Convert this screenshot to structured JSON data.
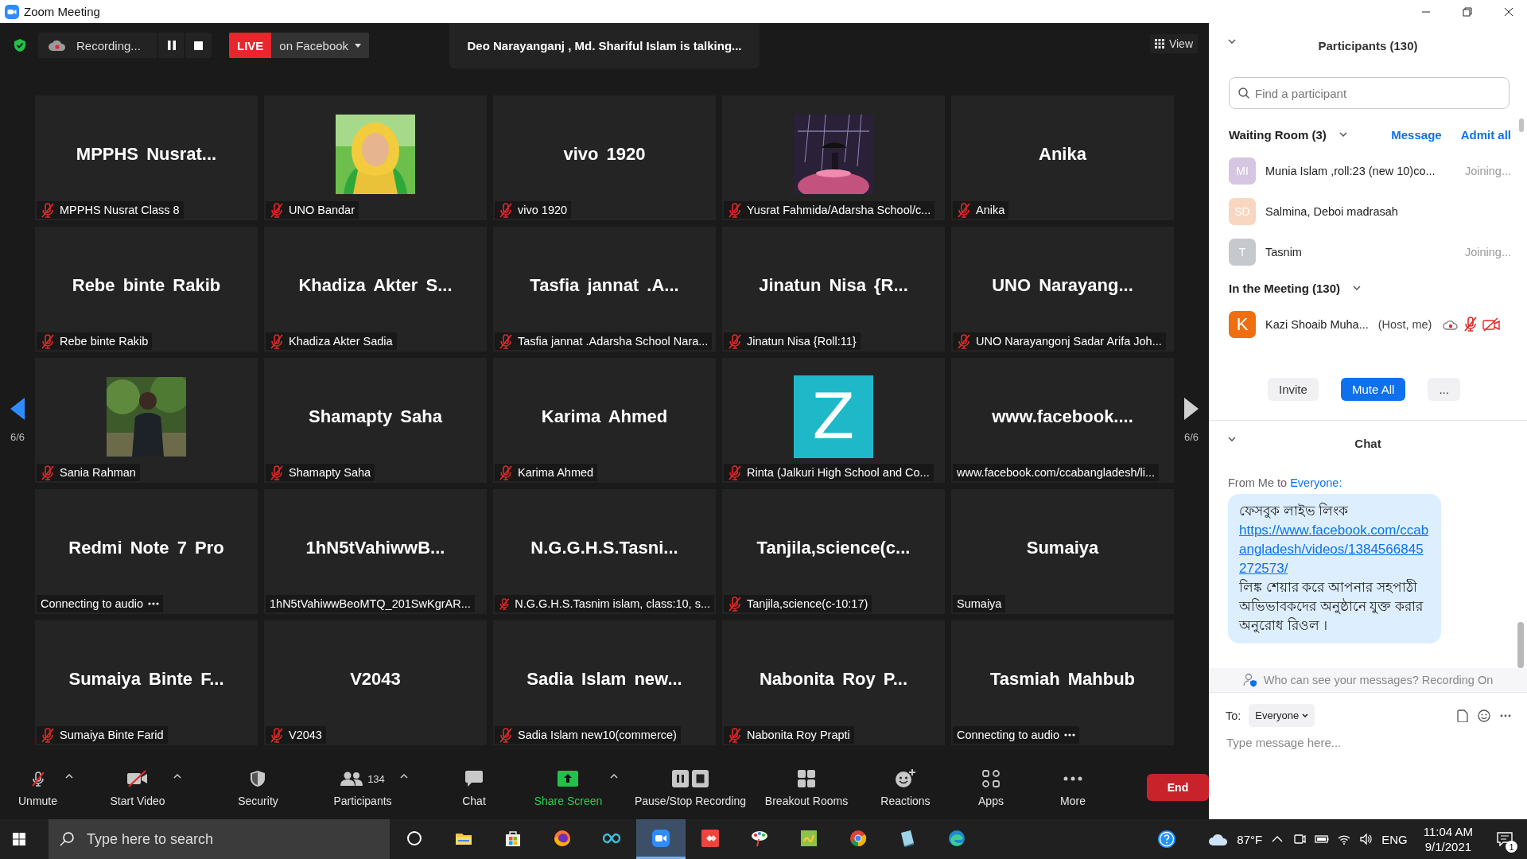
{
  "window": {
    "title": "Zoom Meeting"
  },
  "top_bar": {
    "recording": "Recording...",
    "live_badge": "LIVE",
    "live_target": "on Facebook",
    "talking": "Deo Narayanganj , Md. Shariful Islam is talking...",
    "view": "View"
  },
  "gallery": {
    "page_left": "6/6",
    "page_right": "6/6",
    "tiles": [
      {
        "kind": "name",
        "title": "MPPHS Nusrat...",
        "name": "MPPHS Nusrat Class 8",
        "muted": true,
        "connecting": false
      },
      {
        "kind": "picture",
        "name": "UNO Bandar",
        "muted": true,
        "connecting": false
      },
      {
        "kind": "name",
        "title": "vivo 1920",
        "name": "vivo 1920",
        "muted": true,
        "connecting": false
      },
      {
        "kind": "picture",
        "name": "Yusrat Fahmida/Adarsha School/c...",
        "muted": true,
        "connecting": false
      },
      {
        "kind": "name",
        "title": "Anika",
        "name": "Anika",
        "muted": true,
        "connecting": false
      },
      {
        "kind": "name",
        "title": "Rebe binte Rakib",
        "name": "Rebe binte Rakib",
        "muted": true,
        "connecting": false
      },
      {
        "kind": "name",
        "title": "Khadiza Akter S...",
        "name": "Khadiza Akter Sadia",
        "muted": true,
        "connecting": false
      },
      {
        "kind": "name",
        "title": "Tasfia jannat .A...",
        "name": "Tasfia jannat .Adarsha School Nara...",
        "muted": true,
        "connecting": false
      },
      {
        "kind": "name",
        "title": "Jinatun Nisa {R...",
        "name": "Jinatun Nisa {Roll:11}",
        "muted": true,
        "connecting": false
      },
      {
        "kind": "name",
        "title": "UNO Narayang...",
        "name": "UNO Narayangonj Sadar Arifa Joh...",
        "muted": true,
        "connecting": false
      },
      {
        "kind": "picture",
        "name": "Sania Rahman",
        "muted": true,
        "connecting": false
      },
      {
        "kind": "name",
        "title": "Shamapty Saha",
        "name": "Shamapty Saha",
        "muted": true,
        "connecting": false
      },
      {
        "kind": "name",
        "title": "Karima Ahmed",
        "name": "Karima Ahmed",
        "muted": true,
        "connecting": false
      },
      {
        "kind": "letter",
        "letter": "Z",
        "name": "Rinta (Jalkuri High  School  and Co...",
        "muted": true,
        "connecting": false
      },
      {
        "kind": "name",
        "title": "www.facebook....",
        "name": "www.facebook.com/ccabangladesh/li...",
        "muted": false,
        "connecting": false
      },
      {
        "kind": "name",
        "title": "Redmi Note 7 Pro",
        "name": "Connecting to audio",
        "muted": false,
        "connecting": true
      },
      {
        "kind": "name",
        "title": "1hN5tVahiwwB...",
        "name": "1hN5tVahiwwBeoMTQ_201SwKgrAR...",
        "muted": false,
        "connecting": false
      },
      {
        "kind": "name",
        "title": "N.G.G.H.S.Tasni...",
        "name": "N.G.G.H.S.Tasnim islam, class:10, s...",
        "muted": true,
        "connecting": false
      },
      {
        "kind": "name",
        "title": "Tanjila,science(c...",
        "name": "Tanjila,science(c-10:17)",
        "muted": true,
        "connecting": false
      },
      {
        "kind": "name",
        "title": "Sumaiya",
        "name": "Sumaiya",
        "muted": false,
        "connecting": false
      },
      {
        "kind": "name",
        "title": "Sumaiya Binte F...",
        "name": "Sumaiya Binte Farid",
        "muted": true,
        "connecting": false
      },
      {
        "kind": "name",
        "title": "V2043",
        "name": "V2043",
        "muted": true,
        "connecting": false
      },
      {
        "kind": "name",
        "title": "Sadia Islam new...",
        "name": "Sadia Islam new10(commerce)",
        "muted": true,
        "connecting": false
      },
      {
        "kind": "name",
        "title": "Nabonita Roy P...",
        "name": "Nabonita Roy Prapti",
        "muted": true,
        "connecting": false
      },
      {
        "kind": "name",
        "title": "Tasmiah Mahbub",
        "name": "Connecting to audio",
        "muted": false,
        "connecting": true
      }
    ]
  },
  "toolbar": {
    "items": [
      {
        "kind": "mic",
        "label": "Unmute",
        "off": true,
        "menu": true
      },
      {
        "kind": "video",
        "label": "Start Video",
        "off": true,
        "menu": true
      },
      {
        "kind": "security",
        "label": "Security",
        "menu": false
      },
      {
        "kind": "participants",
        "label": "Participants",
        "count": "134",
        "menu": true
      },
      {
        "kind": "chat",
        "label": "Chat",
        "menu": false
      },
      {
        "kind": "share",
        "label": "Share Screen",
        "menu": true
      },
      {
        "kind": "recording",
        "label": "Pause/Stop Recording",
        "menu": false
      },
      {
        "kind": "breakout",
        "label": "Breakout Rooms",
        "menu": false
      },
      {
        "kind": "reactions",
        "label": "Reactions",
        "menu": false
      },
      {
        "kind": "apps",
        "label": "Apps",
        "menu": false
      },
      {
        "kind": "more",
        "label": "More",
        "menu": false
      }
    ],
    "end": "End"
  },
  "participants": {
    "title": "Participants (130)",
    "search": {
      "placeholder": "Find a participant"
    },
    "waiting_room": {
      "title": "Waiting Room (3)",
      "expanded": true,
      "message": "Message",
      "admit_all": "Admit all",
      "items": [
        {
          "initials": "MI",
          "color": "#d6c6e1",
          "name": "Munia Islam ,roll:23 (new 10)co...",
          "status": "Joining..."
        },
        {
          "initials": "SD",
          "color": "#f9d6bf",
          "name": "Salmina, Deboi madrasah"
        },
        {
          "initials": "T",
          "color": "#c5c8cc",
          "name": "Tasnim",
          "status": "Joining..."
        }
      ]
    },
    "in_meeting": {
      "title": "In the Meeting (130)",
      "expanded": true,
      "items": [
        {
          "initials": "K",
          "color": "#ee6e10",
          "name": "Kazi Shoaib Muha...",
          "role": "(Host, me)",
          "recording": true,
          "muted": true,
          "video_off": true
        }
      ]
    },
    "buttons": {
      "invite": "Invite",
      "mute_all": "Mute All",
      "more": "..."
    }
  },
  "chat": {
    "title": "Chat",
    "from": "From Me to",
    "to": "Everyone:",
    "message": {
      "heading": "ফেসবুক লাইভ লিংক",
      "link": "https://www.facebook.com/ccabangladesh/videos/1384566845272573/",
      "body": "লিঙ্ক শেয়ার করে আপনার সহপাঠী অভিভাবকদের অনুষ্ঠানে যুক্ত করার অনুরোধ রিওল ।"
    },
    "notice": "Who can see your messages? Recording On",
    "to_label": "To:",
    "recipient": "Everyone",
    "input": {
      "placeholder": "Type message here..."
    }
  },
  "taskbar": {
    "search": {
      "placeholder": "Type here to search"
    },
    "apps": [
      {
        "kind": "cortana",
        "active": false
      },
      {
        "kind": "explorer",
        "active": false
      },
      {
        "kind": "store",
        "active": false
      },
      {
        "kind": "firefox",
        "active": false
      },
      {
        "kind": "infinity",
        "active": false
      },
      {
        "kind": "zoom",
        "active": true
      },
      {
        "kind": "anydesk",
        "active": false
      },
      {
        "kind": "paint",
        "active": false
      },
      {
        "kind": "notes",
        "active": false
      },
      {
        "kind": "chrome",
        "active": false
      },
      {
        "kind": "book",
        "active": false
      },
      {
        "kind": "edge",
        "active": false
      }
    ],
    "weather": "87°F",
    "language": "ENG",
    "time": "11:04 AM",
    "date": "9/1/2021",
    "notifications": "1"
  }
}
